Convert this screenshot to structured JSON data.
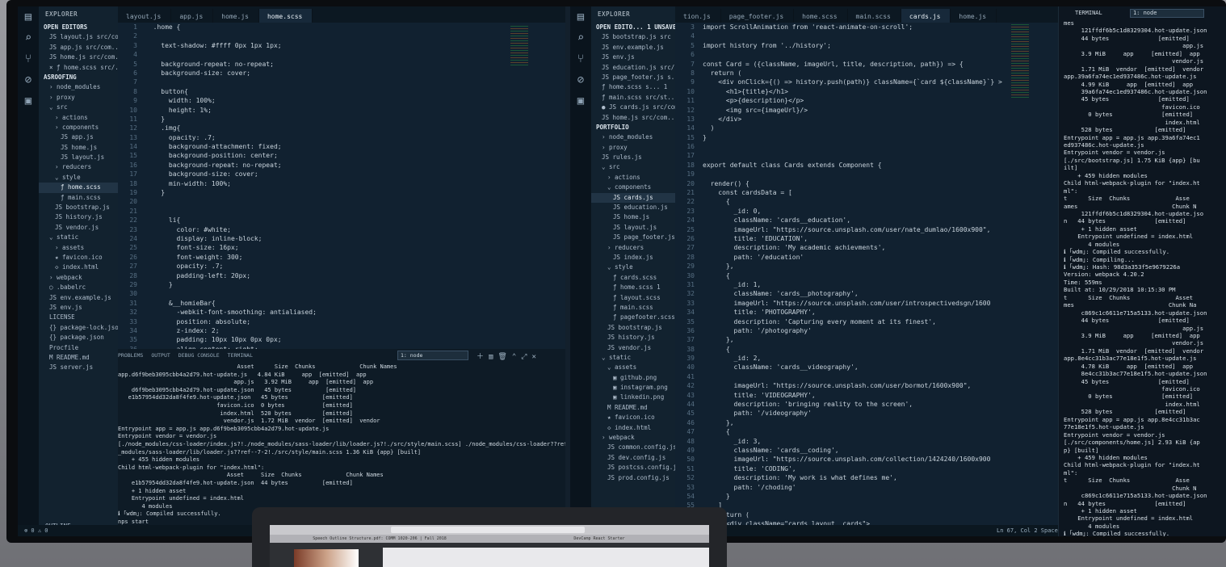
{
  "left": {
    "tabs": [
      "layout.js",
      "app.js",
      "home.js",
      "home.scss"
    ],
    "active_tab": 3,
    "explorer_title": "EXPLORER",
    "explorer": [
      {
        "t": "OPEN EDITORS",
        "i": 0
      },
      {
        "t": "JS layout.js src/com...",
        "i": 1
      },
      {
        "t": "JS app.js src/com...",
        "i": 1
      },
      {
        "t": "JS home.js src/com...",
        "i": 1
      },
      {
        "t": "× ƒ home.scss src/...",
        "i": 1
      },
      {
        "t": "ASROOFING",
        "i": 0
      },
      {
        "t": "› node_modules",
        "i": 1
      },
      {
        "t": "› proxy",
        "i": 1
      },
      {
        "t": "⌄ src",
        "i": 1
      },
      {
        "t": "› actions",
        "i": 2
      },
      {
        "t": "› components",
        "i": 2
      },
      {
        "t": "JS app.js",
        "i": 3
      },
      {
        "t": "JS home.js",
        "i": 3
      },
      {
        "t": "JS layout.js",
        "i": 3
      },
      {
        "t": "› reducers",
        "i": 2
      },
      {
        "t": "⌄ style",
        "i": 2
      },
      {
        "t": "ƒ home.scss",
        "i": 3
      },
      {
        "t": "ƒ main.scss",
        "i": 3
      },
      {
        "t": "JS bootstrap.js",
        "i": 2
      },
      {
        "t": "JS history.js",
        "i": 2
      },
      {
        "t": "JS vendor.js",
        "i": 2
      },
      {
        "t": "⌄ static",
        "i": 1
      },
      {
        "t": "› assets",
        "i": 2
      },
      {
        "t": "★ favicon.ico",
        "i": 2
      },
      {
        "t": "◇ index.html",
        "i": 2
      },
      {
        "t": "› webpack",
        "i": 1
      },
      {
        "t": "◯ .babelrc",
        "i": 1
      },
      {
        "t": "JS env.example.js",
        "i": 1
      },
      {
        "t": "JS env.js",
        "i": 1
      },
      {
        "t": "LICENSE",
        "i": 1
      },
      {
        "t": "{} package-lock.json",
        "i": 1
      },
      {
        "t": "{} package.json",
        "i": 1
      },
      {
        "t": "Procfile",
        "i": 1
      },
      {
        "t": "M README.md",
        "i": 1
      },
      {
        "t": "JS server.js",
        "i": 1
      }
    ],
    "outline_label": "OUTLINE",
    "code": [
      "  .home {",
      "",
      "    text-shadow: #ffff 0px 1px 1px;",
      "",
      "    background-repeat: no-repeat;",
      "    background-size: cover;",
      "",
      "    button{",
      "      width: 100%;",
      "      height: 1%;",
      "    }",
      "    .img{",
      "      opacity: .7;",
      "      background-attachment: fixed;",
      "      background-position: center;",
      "      background-repeat: no-repeat;",
      "      background-size: cover;",
      "      min-width: 100%;",
      "    }",
      "",
      "",
      "      li{",
      "        color: #white;",
      "        display: inline-block;",
      "        font-size: 16px;",
      "        font-weight: 300;",
      "        opacity: .7;",
      "        padding-left: 20px;",
      "      }",
      "",
      "      &__homieBar{",
      "        -webkit-font-smoothing: antialiased;",
      "        position: absolute;",
      "        z-index: 2;",
      "        padding: 10px 10px 0px 0px;",
      "        align-content: right;",
      "      }",
      "",
      "    h1{",
      "      color: #white;"
    ],
    "panel_tabs": [
      "PROBLEMS",
      "OUTPUT",
      "DEBUG CONSOLE",
      "TERMINAL"
    ],
    "panel_select": "1: node",
    "terminal": [
      "                                   Asset      Size  Chunks             Chunk Names",
      "app.d6f9beb3095cbb4a2d79.hot-update.js   4.84 KiB     app  [emitted]  app",
      "                                  app.js   3.92 MiB     app  [emitted]  app",
      "    d6f9beb3095cbb4a2d79.hot-update.json   45 bytes          [emitted]",
      "   e1b57954dd32da8f4fe9.hot-update.json   45 bytes          [emitted]",
      "                             favicon.ico  0 bytes           [emitted]",
      "                              index.html  520 bytes         [emitted]",
      "                               vendor.js  1.72 MiB  vendor  [emitted]  vendor",
      "Entrypoint app = app.js app.d6f9beb3095cbb4a2d79.hot-update.js",
      "Entrypoint vendor = vendor.js",
      "[./node_modules/css-loader/index.js?!./node_modules/sass-loader/lib/loader.js?!./src/style/main.scss] ./node_modules/css-loader??ref--7-1!./node",
      "_modules/sass-loader/lib/loader.js??ref--7-2!./src/style/main.scss 1.36 KiB {app} [built]",
      "    + 455 hidden modules",
      "Child html-webpack-plugin for \"index.html\":",
      "                                Asset     Size  Chunks             Chunk Names",
      "    e1b57954dd32da8f4fe9.hot-update.json  44 bytes          [emitted]",
      "    + 1 hidden asset",
      "    Entrypoint undefined = index.html",
      "       4 modules",
      "ℹ ｢wdm｣: Compiled successfully.",
      "nps start"
    ]
  },
  "right": {
    "tabs": [
      "tion.js",
      "page_footer.js",
      "home.scss",
      "main.scss",
      "cards.js",
      "home.js"
    ],
    "active_tab": 4,
    "explorer_title": "EXPLORER",
    "explorer": [
      {
        "t": "OPEN EDITO...  1 UNSAVED",
        "i": 0
      },
      {
        "t": "JS bootstrap.js src",
        "i": 1
      },
      {
        "t": "JS env.example.js",
        "i": 1
      },
      {
        "t": "JS env.js",
        "i": 1
      },
      {
        "t": "JS education.js src/...",
        "i": 1
      },
      {
        "t": "JS page_footer.js s...",
        "i": 1
      },
      {
        "t": "ƒ home.scss s...  1",
        "i": 1
      },
      {
        "t": "ƒ main.scss src/st...",
        "i": 1
      },
      {
        "t": "● JS cards.js src/com...",
        "i": 1
      },
      {
        "t": "JS home.js src/com...",
        "i": 1
      },
      {
        "t": "PORTFOLIO",
        "i": 0
      },
      {
        "t": "› node_modules",
        "i": 1
      },
      {
        "t": "› proxy",
        "i": 1
      },
      {
        "t": "JS rules.js",
        "i": 1
      },
      {
        "t": "⌄ src",
        "i": 1
      },
      {
        "t": "› actions",
        "i": 2
      },
      {
        "t": "⌄ components",
        "i": 2
      },
      {
        "t": "JS cards.js",
        "i": 3
      },
      {
        "t": "JS education.js",
        "i": 3
      },
      {
        "t": "JS home.js",
        "i": 3
      },
      {
        "t": "JS layout.js",
        "i": 3
      },
      {
        "t": "JS page_footer.js",
        "i": 3
      },
      {
        "t": "› reducers",
        "i": 2
      },
      {
        "t": "JS index.js",
        "i": 3
      },
      {
        "t": "⌄ style",
        "i": 2
      },
      {
        "t": "ƒ cards.scss",
        "i": 3
      },
      {
        "t": "ƒ home.scss  1",
        "i": 3
      },
      {
        "t": "ƒ layout.scss",
        "i": 3
      },
      {
        "t": "ƒ main.scss",
        "i": 3
      },
      {
        "t": "ƒ pagefooter.scss",
        "i": 3
      },
      {
        "t": "JS bootstrap.js",
        "i": 2
      },
      {
        "t": "JS history.js",
        "i": 2
      },
      {
        "t": "JS vendor.js",
        "i": 2
      },
      {
        "t": "⌄ static",
        "i": 1
      },
      {
        "t": "⌄ assets",
        "i": 2
      },
      {
        "t": "▣ github.png",
        "i": 3
      },
      {
        "t": "▣ instagram.png",
        "i": 3
      },
      {
        "t": "▣ linkedin.png",
        "i": 3
      },
      {
        "t": "M README.md",
        "i": 2
      },
      {
        "t": "★ favicon.ico",
        "i": 2
      },
      {
        "t": "◇ index.html",
        "i": 2
      },
      {
        "t": "› webpack",
        "i": 1
      },
      {
        "t": "JS common.config.js",
        "i": 2
      },
      {
        "t": "JS dev.config.js",
        "i": 2
      },
      {
        "t": "JS postcss.config.js",
        "i": 2
      },
      {
        "t": "JS prod.config.js",
        "i": 2
      }
    ],
    "code_start": 3,
    "code": [
      "import ScrollAnimation from 'react-animate-on-scroll';",
      "",
      "import history from '../history';",
      "",
      "const Card = ({className, imageUrl, title, description, path}) => {",
      "  return (",
      "    <div onClick={() => history.push(path)} className={`card ${className}`} >",
      "      <h1>{title}</h1>",
      "      <p>{description}</p>",
      "      <img src={imageUrl}/>",
      "    </div>",
      "  )",
      "}",
      "",
      "",
      "export default class Cards extends Component {",
      "",
      "  render() {",
      "    const cardsData = [",
      "      {",
      "        _id: 0,",
      "        className: 'cards__education',",
      "        imageUrl: \"https://source.unsplash.com/user/nate_dumlao/1600x900\",",
      "        title: 'EDUCATION',",
      "        description: 'My academic achievments',",
      "        path: '/education'",
      "      },",
      "      {",
      "        _id: 1,",
      "        className: 'cards__photography',",
      "        imageUrl: \"https://source.unsplash.com/user/introspectivedsgn/1600",
      "        title: 'PHOTOGRAPHY',",
      "        description: 'Capturing every moment at its finest',",
      "        path: '/photography'",
      "      },",
      "      {",
      "        _id: 2,",
      "        className: 'cards__videography',",
      "",
      "        imageUrl: \"https://source.unsplash.com/user/bormot/1600x900\",",
      "        title: 'VIDEOGRAPHY',",
      "        description: 'bringing reality to the screen',",
      "        path: '/videography'",
      "      },",
      "      {",
      "        _id: 3,",
      "        className: 'cards__coding',",
      "        imageUrl: \"https://source.unsplash.com/collection/1424240/1600x900",
      "        title: 'CODING',",
      "        description: 'My work is what defines me',",
      "        path: '/choding'",
      "      }",
      "    ]",
      "    return (",
      "      <div className=\"cards layout__cards\">",
      "        {",
      "          cardsData.map(cardObject => {"
    ],
    "status": "Ln 67, Col 2    Spaces: 4    UTF-8",
    "terminal_title": "TERMINAL",
    "terminal_select": "1: node",
    "terminal": [
      "mes",
      "     121ffdf6b5c1d8329304.hot-update.json",
      "     44 bytes              [emitted]",
      "                                  app.js",
      "     3.9 MiB     app     [emitted]  app",
      "                               vendor.js",
      "     1.71 MiB  vendor  [emitted]  vendor",
      "app.39a6fa74ec1ed937486c.hot-update.js",
      "     4.99 KiB     app  [emitted]  app",
      "     39a6fa74ec1ed937486c.hot-update.json",
      "     45 bytes              [emitted]",
      "                            favicon.ico",
      "       0 bytes              [emitted]",
      "                             index.html",
      "     528 bytes            [emitted]",
      "Entrypoint app = app.js app.39a6fa74ec1",
      "ed937486c.hot-update.js",
      "Entrypoint vendor = vendor.js",
      "[./src/bootstrap.js] 1.75 KiB {app} [bu",
      "ilt]",
      "    + 459 hidden modules",
      "Child html-webpack-plugin for \"index.ht",
      "ml\":",
      "t      Size  Chunks             Asse",
      "ames                           Chunk N",
      "     121ffdf6b5c1d8329304.hot-update.jso",
      "n   44 bytes              [emitted]",
      "     + 1 hidden asset",
      "    Entrypoint undefined = index.html",
      "       4 modules",
      "ℹ ｢wdm｣: Compiled successfully.",
      "ℹ ｢wdm｣: Compiling...",
      "ℹ ｢wdm｣: Hash: 98d3a353f5e9679226a",
      "Version: webpack 4.20.2",
      "Time: 559ms",
      "Built at: 10/29/2018 10:15:30 PM",
      "t      Size  Chunks             Asset",
      "mes                           Chunk Na",
      "     c869c1c6611e715a5133.hot-update.json",
      "     44 bytes              [emitted]",
      "                                  app.js",
      "     3.9 MiB     app     [emitted]  app",
      "                               vendor.js",
      "     1.71 MiB  vendor  [emitted]  vendor",
      "app.8e4cc31b3ac77e18e1f5.hot-update.js",
      "     4.78 KiB     app  [emitted]  app",
      "     8e4cc31b3ac77e18e1f5.hot-update.json",
      "     45 bytes              [emitted]",
      "                            favicon.ico",
      "       0 bytes              [emitted]",
      "                             index.html",
      "     528 bytes            [emitted]",
      "Entrypoint app = app.js app.8e4cc31b3ac",
      "77e18e1f5.hot-update.js",
      "Entrypoint vendor = vendor.js",
      "[./src/components/home.js] 2.93 KiB {ap",
      "p} [built]",
      "    + 459 hidden modules",
      "Child html-webpack-plugin for \"index.ht",
      "ml\":",
      "t      Size  Chunks             Asse",
      "                               Chunk N",
      "     c869c1c6611e715a5133.hot-update.json",
      "n   44 bytes              [emitted]",
      "     + 1 hidden asset",
      "    Entrypoint undefined = index.html",
      "       4 modules",
      "ℹ ｢wdm｣: Compiled successfully."
    ]
  },
  "laptop": {
    "tabs": [
      "Speech Outline Structure.pdf: COMM 1020-206 | Fall 2018",
      "DevCamp React Starter"
    ],
    "url": "localhost"
  }
}
